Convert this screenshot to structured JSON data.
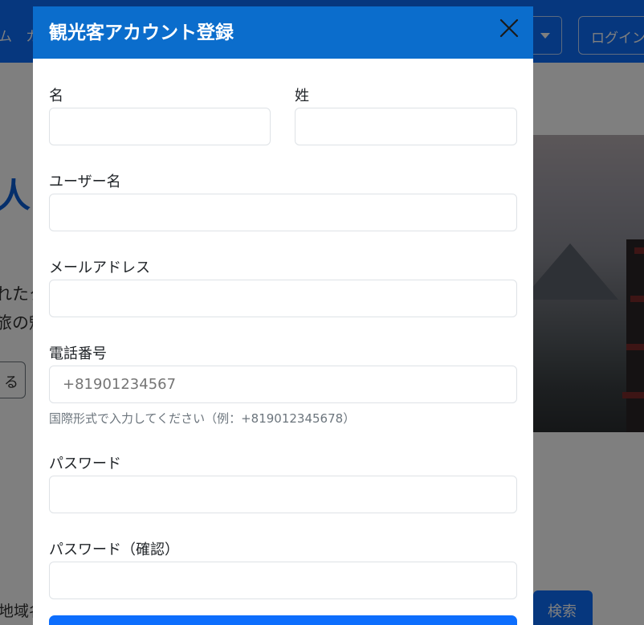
{
  "background": {
    "nav": {
      "link_1": "ム",
      "link_2": "カ",
      "login_label": "ログイン"
    },
    "hero": {
      "heading": "人",
      "text_line_1": "れたク",
      "text_line_2": "旅の魅",
      "button_label": "る"
    },
    "search": {
      "input_text": "地域名",
      "button_label": "検索"
    }
  },
  "modal": {
    "title": "観光客アカウント登録",
    "fields": {
      "first_name": {
        "label": "名",
        "value": ""
      },
      "last_name": {
        "label": "姓",
        "value": ""
      },
      "username": {
        "label": "ユーザー名",
        "value": ""
      },
      "email": {
        "label": "メールアドレス",
        "value": ""
      },
      "phone": {
        "label": "電話番号",
        "placeholder": "+81901234567",
        "help": "国際形式で入力してください（例：+819012345678）"
      },
      "password": {
        "label": "パスワード",
        "value": ""
      },
      "password_confirm": {
        "label": "パスワード（確認）",
        "value": ""
      }
    }
  },
  "colors": {
    "primary": "#0d6efd",
    "modal_header": "#0b6dcc"
  }
}
